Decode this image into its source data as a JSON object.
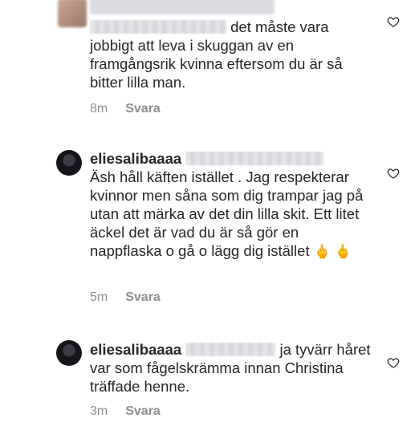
{
  "comments": [
    {
      "username": "",
      "text": "det måste vara jobbigt att leva i skuggan av en framgångsrik kvinna eftersom du är så bitter lilla man.",
      "time": "8m",
      "reply_label": "Svara"
    },
    {
      "username": "eliesalibaaaa",
      "text": "Äsh håll käften istället . Jag respekterar kvinnor men såna som dig trampar jag på utan att märka av det din lilla skit. Ett litet äckel det är vad du är så gör en nappflaska o gå o lägg dig istället",
      "emoji": "🖕 🖕",
      "time": "5m",
      "reply_label": "Svara"
    },
    {
      "username": "eliesalibaaaa",
      "text": "ja tyvärr håret var som fågelskrämma innan Christina träffade henne.",
      "time": "3m",
      "reply_label": "Svara"
    }
  ],
  "icons": {
    "like": "heart-outline-icon"
  },
  "colors": {
    "text": "#262626",
    "meta": "#8e8e8e"
  }
}
